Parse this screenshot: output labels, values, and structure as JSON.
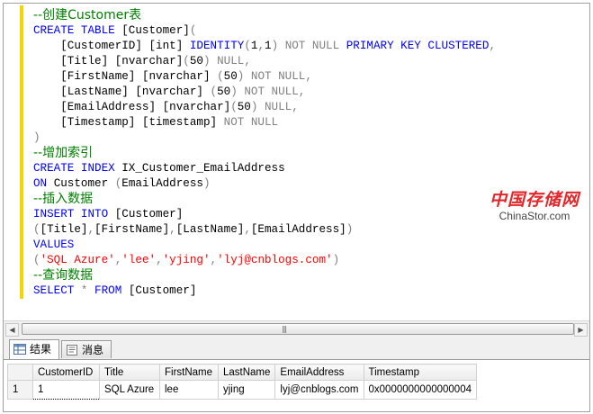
{
  "editor": {
    "lines": [
      [
        {
          "t": "--创建Customer表",
          "c": "cm"
        }
      ],
      [
        {
          "t": "CREATE TABLE ",
          "c": "kw"
        },
        {
          "t": "[Customer]",
          "c": "tx"
        },
        {
          "t": "(",
          "c": "gy"
        }
      ],
      [
        {
          "t": "    ",
          "c": "tx"
        },
        {
          "t": "[CustomerID] ",
          "c": "tx"
        },
        {
          "t": "[int] ",
          "c": "tx"
        },
        {
          "t": "IDENTITY",
          "c": "kw"
        },
        {
          "t": "(",
          "c": "gy"
        },
        {
          "t": "1",
          "c": "tx"
        },
        {
          "t": ",",
          "c": "gy"
        },
        {
          "t": "1",
          "c": "tx"
        },
        {
          "t": ") ",
          "c": "gy"
        },
        {
          "t": "NOT NULL ",
          "c": "gy"
        },
        {
          "t": "PRIMARY KEY CLUSTERED",
          "c": "kw"
        },
        {
          "t": ",",
          "c": "gy"
        }
      ],
      [
        {
          "t": "    ",
          "c": "tx"
        },
        {
          "t": "[Title] ",
          "c": "tx"
        },
        {
          "t": "[nvarchar]",
          "c": "tx"
        },
        {
          "t": "(",
          "c": "gy"
        },
        {
          "t": "50",
          "c": "tx"
        },
        {
          "t": ") ",
          "c": "gy"
        },
        {
          "t": "NULL",
          "c": "gy"
        },
        {
          "t": ",",
          "c": "gy"
        }
      ],
      [
        {
          "t": "    ",
          "c": "tx"
        },
        {
          "t": "[FirstName] ",
          "c": "tx"
        },
        {
          "t": "[nvarchar] ",
          "c": "tx"
        },
        {
          "t": "(",
          "c": "gy"
        },
        {
          "t": "50",
          "c": "tx"
        },
        {
          "t": ") ",
          "c": "gy"
        },
        {
          "t": "NOT NULL",
          "c": "gy"
        },
        {
          "t": ",",
          "c": "gy"
        }
      ],
      [
        {
          "t": "    ",
          "c": "tx"
        },
        {
          "t": "[LastName] ",
          "c": "tx"
        },
        {
          "t": "[nvarchar] ",
          "c": "tx"
        },
        {
          "t": "(",
          "c": "gy"
        },
        {
          "t": "50",
          "c": "tx"
        },
        {
          "t": ") ",
          "c": "gy"
        },
        {
          "t": "NOT NULL",
          "c": "gy"
        },
        {
          "t": ",",
          "c": "gy"
        }
      ],
      [
        {
          "t": "    ",
          "c": "tx"
        },
        {
          "t": "[EmailAddress] ",
          "c": "tx"
        },
        {
          "t": "[nvarchar]",
          "c": "tx"
        },
        {
          "t": "(",
          "c": "gy"
        },
        {
          "t": "50",
          "c": "tx"
        },
        {
          "t": ") ",
          "c": "gy"
        },
        {
          "t": "NULL",
          "c": "gy"
        },
        {
          "t": ",",
          "c": "gy"
        }
      ],
      [
        {
          "t": "    ",
          "c": "tx"
        },
        {
          "t": "[Timestamp] ",
          "c": "tx"
        },
        {
          "t": "[timestamp] ",
          "c": "tx"
        },
        {
          "t": "NOT NULL",
          "c": "gy"
        }
      ],
      [
        {
          "t": ")",
          "c": "gy"
        }
      ],
      [
        {
          "t": "--增加索引",
          "c": "cm"
        }
      ],
      [
        {
          "t": "CREATE INDEX ",
          "c": "kw"
        },
        {
          "t": "IX_Customer_EmailAddress",
          "c": "tx"
        }
      ],
      [
        {
          "t": "ON ",
          "c": "kw"
        },
        {
          "t": "Customer ",
          "c": "tx"
        },
        {
          "t": "(",
          "c": "gy"
        },
        {
          "t": "EmailAddress",
          "c": "tx"
        },
        {
          "t": ")",
          "c": "gy"
        }
      ],
      [
        {
          "t": "--插入数据",
          "c": "cm"
        }
      ],
      [
        {
          "t": "INSERT INTO ",
          "c": "kw"
        },
        {
          "t": "[Customer]",
          "c": "tx"
        }
      ],
      [
        {
          "t": "(",
          "c": "gy"
        },
        {
          "t": "[Title]",
          "c": "tx"
        },
        {
          "t": ",",
          "c": "gy"
        },
        {
          "t": "[FirstName]",
          "c": "tx"
        },
        {
          "t": ",",
          "c": "gy"
        },
        {
          "t": "[LastName]",
          "c": "tx"
        },
        {
          "t": ",",
          "c": "gy"
        },
        {
          "t": "[EmailAddress]",
          "c": "tx"
        },
        {
          "t": ")",
          "c": "gy"
        }
      ],
      [
        {
          "t": "VALUES",
          "c": "kw"
        }
      ],
      [
        {
          "t": "(",
          "c": "gy"
        },
        {
          "t": "'SQL Azure'",
          "c": "st"
        },
        {
          "t": ",",
          "c": "gy"
        },
        {
          "t": "'lee'",
          "c": "st"
        },
        {
          "t": ",",
          "c": "gy"
        },
        {
          "t": "'yjing'",
          "c": "st"
        },
        {
          "t": ",",
          "c": "gy"
        },
        {
          "t": "'lyj@cnblogs.com'",
          "c": "st"
        },
        {
          "t": ")",
          "c": "gy"
        }
      ],
      [
        {
          "t": "--查询数据",
          "c": "cm"
        }
      ],
      [
        {
          "t": "SELECT ",
          "c": "kw"
        },
        {
          "t": "* ",
          "c": "gy"
        },
        {
          "t": "FROM ",
          "c": "kw"
        },
        {
          "t": "[Customer]",
          "c": "tx"
        }
      ]
    ]
  },
  "watermark": {
    "cn": "中国存储网",
    "en": "ChinaStor.com"
  },
  "tabs": {
    "results_label": "结果",
    "messages_label": "消息"
  },
  "grid": {
    "columns": [
      "CustomerID",
      "Title",
      "FirstName",
      "LastName",
      "EmailAddress",
      "Timestamp"
    ],
    "rows": [
      {
        "num": "1",
        "cells": [
          "1",
          "SQL Azure",
          "lee",
          "yjing",
          "lyj@cnblogs.com",
          "0x0000000000000004"
        ]
      }
    ]
  },
  "colors": {
    "keyword": "#0000ff",
    "comment": "#008000",
    "operator": "#808080",
    "string": "#ff0000",
    "margin_bar": "#f0d800"
  }
}
